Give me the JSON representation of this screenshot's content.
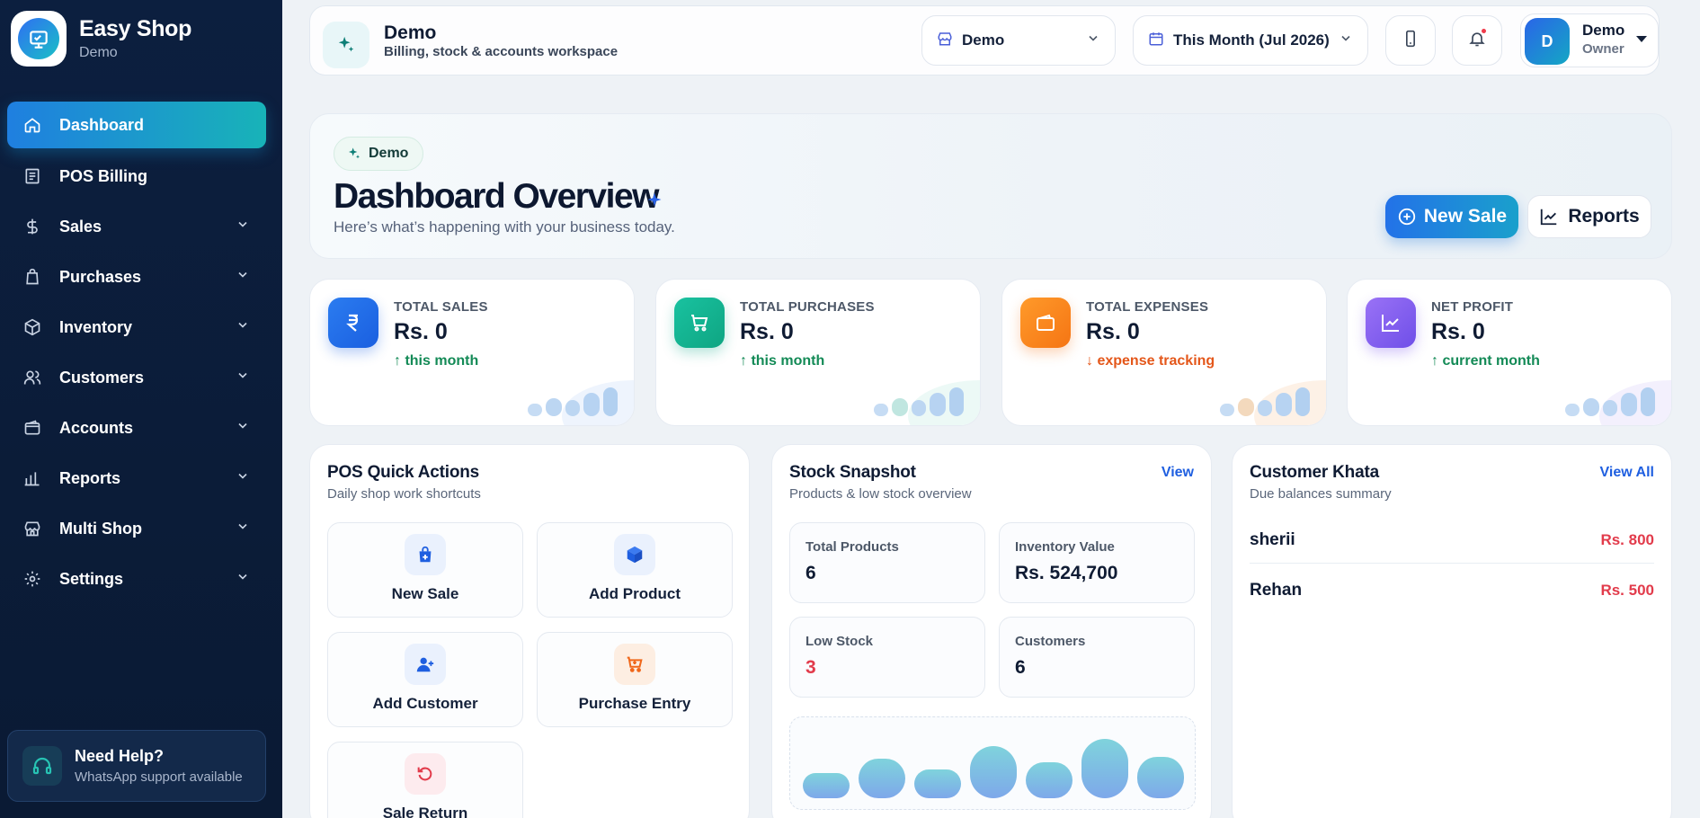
{
  "brand": {
    "title": "Easy Shop",
    "subtitle": "Demo"
  },
  "sidebar": {
    "items": [
      {
        "label": "Dashboard",
        "icon": "home-icon",
        "active": true
      },
      {
        "label": "POS Billing",
        "icon": "receipt-icon"
      },
      {
        "label": "Sales",
        "icon": "dollar-icon"
      },
      {
        "label": "Purchases",
        "icon": "bag-icon"
      },
      {
        "label": "Inventory",
        "icon": "box-icon"
      },
      {
        "label": "Customers",
        "icon": "users-icon"
      },
      {
        "label": "Accounts",
        "icon": "wallet-icon"
      },
      {
        "label": "Reports",
        "icon": "bar-chart-icon"
      },
      {
        "label": "Multi Shop",
        "icon": "store-icon"
      },
      {
        "label": "Settings",
        "icon": "gear-icon"
      }
    ],
    "help": {
      "title": "Need Help?",
      "subtitle": "WhatsApp support available"
    }
  },
  "topbar": {
    "workspace_title": "Demo",
    "workspace_subtitle": "Billing, stock & accounts workspace",
    "shop_select": "Demo",
    "date_select": "This Month (Jul 2026)",
    "user_name": "Demo",
    "user_role": "Owner",
    "avatar_initial": "D"
  },
  "hero": {
    "badge": "Demo",
    "title": "Dashboard Overview",
    "subtitle": "Here’s what’s happening with your business today.",
    "new_sale_label": "New Sale",
    "reports_label": "Reports"
  },
  "stats": [
    {
      "label": "TOTAL SALES",
      "value": "Rs. 0",
      "trend": "this month",
      "direction": "up",
      "color": "#1f6fe8"
    },
    {
      "label": "TOTAL PURCHASES",
      "value": "Rs. 0",
      "trend": "this month",
      "direction": "up",
      "color": "#12b08f"
    },
    {
      "label": "TOTAL EXPENSES",
      "value": "Rs. 0",
      "trend": "expense tracking",
      "direction": "down",
      "color": "#f77b1c"
    },
    {
      "label": "NET PROFIT",
      "value": "Rs. 0",
      "trend": "current month",
      "direction": "up",
      "color": "#7b5cf0"
    }
  ],
  "quick_actions": {
    "title": "POS Quick Actions",
    "subtitle": "Daily shop work shortcuts",
    "items": [
      "New Sale",
      "Add Product",
      "Add Customer",
      "Purchase Entry",
      "Sale Return"
    ]
  },
  "stock": {
    "title": "Stock Snapshot",
    "subtitle": "Products & low stock overview",
    "link": "View",
    "tiles": [
      {
        "label": "Total Products",
        "value": "6"
      },
      {
        "label": "Inventory Value",
        "value": "Rs. 524,700"
      },
      {
        "label": "Low Stock",
        "value": "3"
      },
      {
        "label": "Customers",
        "value": "6"
      }
    ]
  },
  "khata": {
    "title": "Customer Khata",
    "subtitle": "Due balances summary",
    "link": "View All",
    "rows": [
      {
        "name": "sherii",
        "amount": "Rs. 800"
      },
      {
        "name": "Rehan",
        "amount": "Rs. 500"
      }
    ]
  },
  "colors": {
    "accent": "#1f7fe0",
    "accent2": "#18b3b8",
    "sidebar": "#0c1f3f",
    "danger": "#e23b4b",
    "success": "#138a56"
  }
}
